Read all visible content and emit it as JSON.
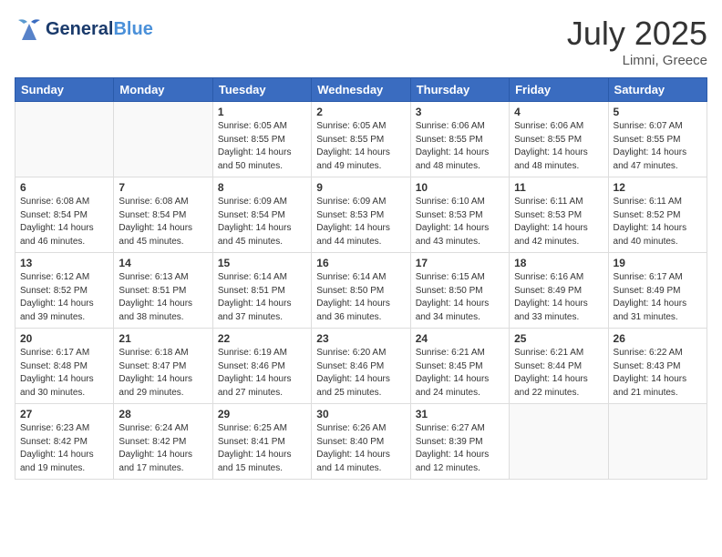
{
  "header": {
    "logo_general": "General",
    "logo_blue": "Blue",
    "month_year": "July 2025",
    "location": "Limni, Greece"
  },
  "days_of_week": [
    "Sunday",
    "Monday",
    "Tuesday",
    "Wednesday",
    "Thursday",
    "Friday",
    "Saturday"
  ],
  "weeks": [
    [
      {
        "day": "",
        "info": ""
      },
      {
        "day": "",
        "info": ""
      },
      {
        "day": "1",
        "info": "Sunrise: 6:05 AM\nSunset: 8:55 PM\nDaylight: 14 hours\nand 50 minutes."
      },
      {
        "day": "2",
        "info": "Sunrise: 6:05 AM\nSunset: 8:55 PM\nDaylight: 14 hours\nand 49 minutes."
      },
      {
        "day": "3",
        "info": "Sunrise: 6:06 AM\nSunset: 8:55 PM\nDaylight: 14 hours\nand 48 minutes."
      },
      {
        "day": "4",
        "info": "Sunrise: 6:06 AM\nSunset: 8:55 PM\nDaylight: 14 hours\nand 48 minutes."
      },
      {
        "day": "5",
        "info": "Sunrise: 6:07 AM\nSunset: 8:55 PM\nDaylight: 14 hours\nand 47 minutes."
      }
    ],
    [
      {
        "day": "6",
        "info": "Sunrise: 6:08 AM\nSunset: 8:54 PM\nDaylight: 14 hours\nand 46 minutes."
      },
      {
        "day": "7",
        "info": "Sunrise: 6:08 AM\nSunset: 8:54 PM\nDaylight: 14 hours\nand 45 minutes."
      },
      {
        "day": "8",
        "info": "Sunrise: 6:09 AM\nSunset: 8:54 PM\nDaylight: 14 hours\nand 45 minutes."
      },
      {
        "day": "9",
        "info": "Sunrise: 6:09 AM\nSunset: 8:53 PM\nDaylight: 14 hours\nand 44 minutes."
      },
      {
        "day": "10",
        "info": "Sunrise: 6:10 AM\nSunset: 8:53 PM\nDaylight: 14 hours\nand 43 minutes."
      },
      {
        "day": "11",
        "info": "Sunrise: 6:11 AM\nSunset: 8:53 PM\nDaylight: 14 hours\nand 42 minutes."
      },
      {
        "day": "12",
        "info": "Sunrise: 6:11 AM\nSunset: 8:52 PM\nDaylight: 14 hours\nand 40 minutes."
      }
    ],
    [
      {
        "day": "13",
        "info": "Sunrise: 6:12 AM\nSunset: 8:52 PM\nDaylight: 14 hours\nand 39 minutes."
      },
      {
        "day": "14",
        "info": "Sunrise: 6:13 AM\nSunset: 8:51 PM\nDaylight: 14 hours\nand 38 minutes."
      },
      {
        "day": "15",
        "info": "Sunrise: 6:14 AM\nSunset: 8:51 PM\nDaylight: 14 hours\nand 37 minutes."
      },
      {
        "day": "16",
        "info": "Sunrise: 6:14 AM\nSunset: 8:50 PM\nDaylight: 14 hours\nand 36 minutes."
      },
      {
        "day": "17",
        "info": "Sunrise: 6:15 AM\nSunset: 8:50 PM\nDaylight: 14 hours\nand 34 minutes."
      },
      {
        "day": "18",
        "info": "Sunrise: 6:16 AM\nSunset: 8:49 PM\nDaylight: 14 hours\nand 33 minutes."
      },
      {
        "day": "19",
        "info": "Sunrise: 6:17 AM\nSunset: 8:49 PM\nDaylight: 14 hours\nand 31 minutes."
      }
    ],
    [
      {
        "day": "20",
        "info": "Sunrise: 6:17 AM\nSunset: 8:48 PM\nDaylight: 14 hours\nand 30 minutes."
      },
      {
        "day": "21",
        "info": "Sunrise: 6:18 AM\nSunset: 8:47 PM\nDaylight: 14 hours\nand 29 minutes."
      },
      {
        "day": "22",
        "info": "Sunrise: 6:19 AM\nSunset: 8:46 PM\nDaylight: 14 hours\nand 27 minutes."
      },
      {
        "day": "23",
        "info": "Sunrise: 6:20 AM\nSunset: 8:46 PM\nDaylight: 14 hours\nand 25 minutes."
      },
      {
        "day": "24",
        "info": "Sunrise: 6:21 AM\nSunset: 8:45 PM\nDaylight: 14 hours\nand 24 minutes."
      },
      {
        "day": "25",
        "info": "Sunrise: 6:21 AM\nSunset: 8:44 PM\nDaylight: 14 hours\nand 22 minutes."
      },
      {
        "day": "26",
        "info": "Sunrise: 6:22 AM\nSunset: 8:43 PM\nDaylight: 14 hours\nand 21 minutes."
      }
    ],
    [
      {
        "day": "27",
        "info": "Sunrise: 6:23 AM\nSunset: 8:42 PM\nDaylight: 14 hours\nand 19 minutes."
      },
      {
        "day": "28",
        "info": "Sunrise: 6:24 AM\nSunset: 8:42 PM\nDaylight: 14 hours\nand 17 minutes."
      },
      {
        "day": "29",
        "info": "Sunrise: 6:25 AM\nSunset: 8:41 PM\nDaylight: 14 hours\nand 15 minutes."
      },
      {
        "day": "30",
        "info": "Sunrise: 6:26 AM\nSunset: 8:40 PM\nDaylight: 14 hours\nand 14 minutes."
      },
      {
        "day": "31",
        "info": "Sunrise: 6:27 AM\nSunset: 8:39 PM\nDaylight: 14 hours\nand 12 minutes."
      },
      {
        "day": "",
        "info": ""
      },
      {
        "day": "",
        "info": ""
      }
    ]
  ]
}
